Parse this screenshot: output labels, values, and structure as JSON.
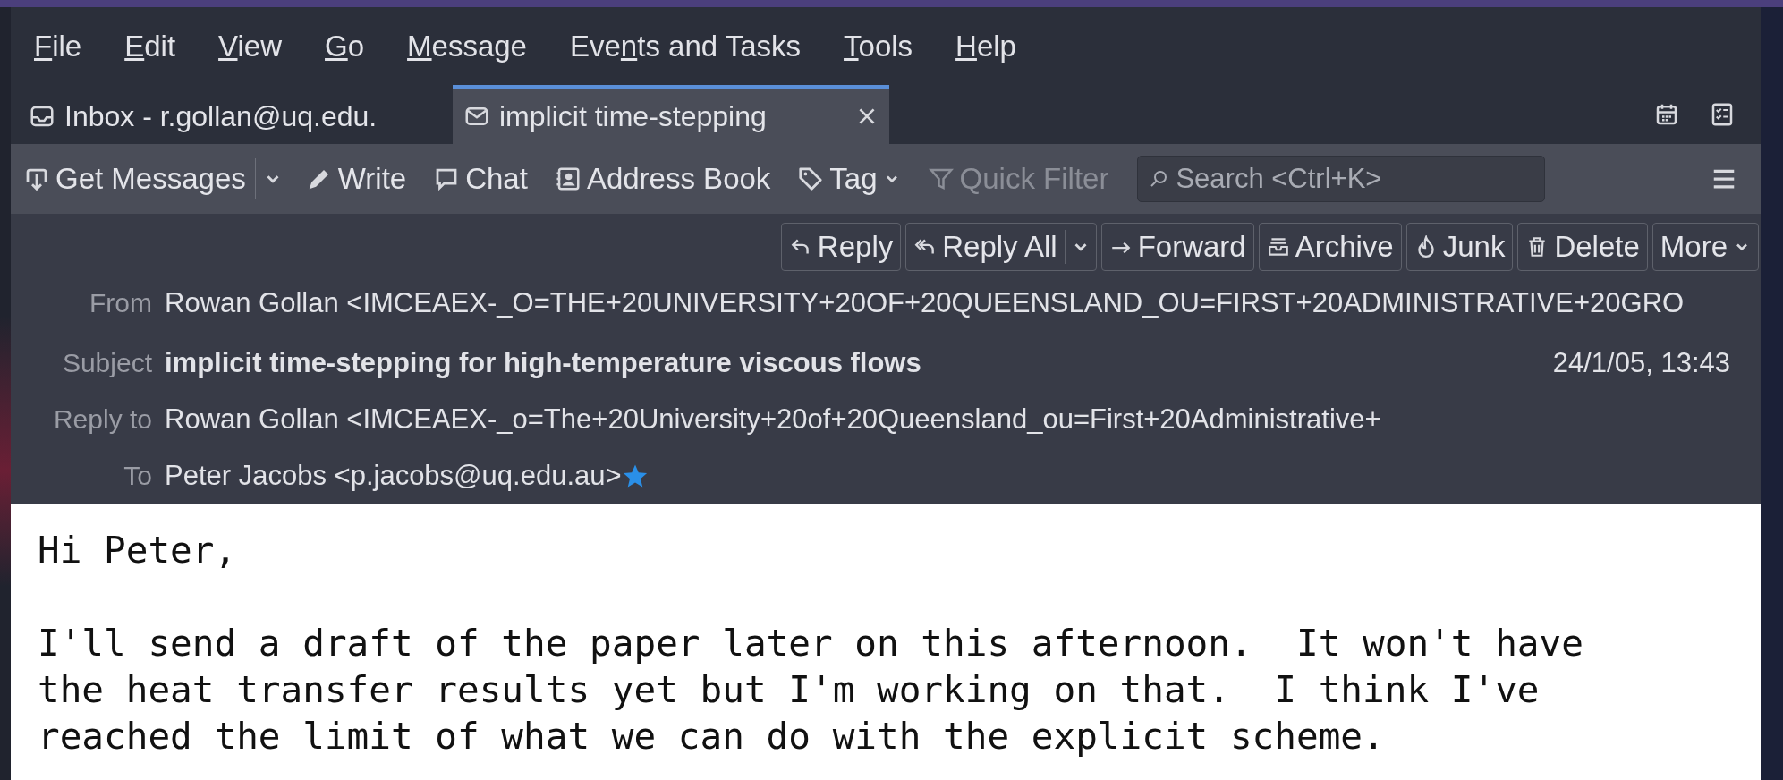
{
  "menu": [
    {
      "key": "F",
      "after": "ile"
    },
    {
      "key": "E",
      "after": "dit"
    },
    {
      "key": "V",
      "after": "iew"
    },
    {
      "key": "G",
      "after": "o"
    },
    {
      "key": "M",
      "after": "essage"
    },
    {
      "before": "Eve",
      "key": "n",
      "after": "ts and Tasks"
    },
    {
      "key": "T",
      "after": "ools"
    },
    {
      "key": "H",
      "after": "elp"
    }
  ],
  "tabs": [
    {
      "kind": "inbox",
      "label": "Inbox - r.gollan@uq.edu.",
      "selected": false
    },
    {
      "kind": "message",
      "label": "implicit time-stepping",
      "selected": true
    }
  ],
  "toolbar": [
    {
      "kind": "get",
      "label": "Get Messages",
      "disabled": false
    },
    {
      "kind": "write",
      "label": "Write",
      "disabled": false
    },
    {
      "kind": "chat",
      "label": "Chat",
      "disabled": false
    },
    {
      "kind": "addressbook",
      "label": "Address Book",
      "disabled": false
    },
    {
      "kind": "tag",
      "label": "Tag",
      "disabled": false
    },
    {
      "kind": "filter",
      "label": "Quick Filter",
      "disabled": true
    }
  ],
  "search": {
    "placeholder": "Search <Ctrl+K>"
  },
  "message_actions": [
    {
      "kind": "reply",
      "label": "Reply"
    },
    {
      "kind": "replyall",
      "label": "Reply All"
    },
    {
      "kind": "forward",
      "label": "Forward"
    },
    {
      "kind": "archive",
      "label": "Archive"
    },
    {
      "kind": "junk",
      "label": "Junk"
    },
    {
      "kind": "delete",
      "label": "Delete"
    },
    {
      "kind": "more",
      "label": "More"
    }
  ],
  "headers": [
    {
      "kind": "plain",
      "label": "From",
      "value": "Rowan Gollan <IMCEAEX-_O=THE+20UNIVERSITY+20OF+20QUEENSLAND_OU=FIRST+20ADMINISTRATIVE+20GRO"
    },
    {
      "kind": "subject",
      "label": "Subject",
      "value": "implicit time-stepping for high-temperature viscous flows",
      "date": "24/1/05, 13:43"
    },
    {
      "kind": "plain",
      "label": "Reply to",
      "value": "Rowan Gollan <IMCEAEX-_o=The+20University+20of+20Queensland_ou=First+20Administrative+"
    },
    {
      "kind": "contact",
      "label": "To",
      "value": "Peter Jacobs <p.jacobs@uq.edu.au>"
    }
  ],
  "body": [
    [
      "Hi Peter,"
    ],
    [
      "I'll send a draft of the paper later on this afternoon.  It won't have",
      "the heat transfer results yet but I'm working on that.  I think I've",
      "reached the limit of what we can do with the explicit scheme."
    ]
  ]
}
